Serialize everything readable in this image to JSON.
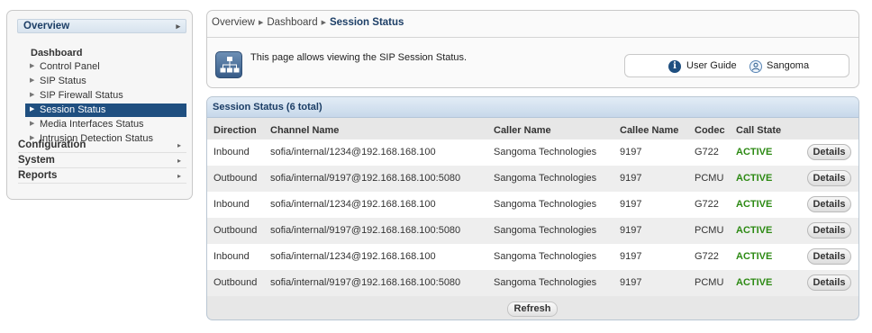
{
  "sidebar": {
    "overview": "Overview",
    "dashboard": "Dashboard",
    "items": [
      "Control Panel",
      "SIP Status",
      "SIP Firewall Status",
      "Session Status",
      "Media Interfaces Status",
      "Intrusion Detection Status"
    ],
    "selected_index": 3,
    "sections": [
      "Configuration",
      "System",
      "Reports"
    ]
  },
  "breadcrumb": {
    "root": "Overview",
    "mid": "Dashboard",
    "current": "Session Status"
  },
  "page": {
    "description": "This page allows viewing the SIP Session Status.",
    "user_guide": "User Guide",
    "user": "Sangoma"
  },
  "sessions": {
    "title": "Session Status (6 total)",
    "columns": [
      "Direction",
      "Channel Name",
      "Caller Name",
      "Callee Name",
      "Codec",
      "Call State"
    ],
    "rows": [
      {
        "direction": "Inbound",
        "channel": "sofia/internal/1234@192.168.168.100",
        "caller": "Sangoma Technologies",
        "callee": "9197",
        "codec": "G722",
        "state": "ACTIVE"
      },
      {
        "direction": "Outbound",
        "channel": "sofia/internal/9197@192.168.168.100:5080",
        "caller": "Sangoma Technologies",
        "callee": "9197",
        "codec": "PCMU",
        "state": "ACTIVE"
      },
      {
        "direction": "Inbound",
        "channel": "sofia/internal/1234@192.168.168.100",
        "caller": "Sangoma Technologies",
        "callee": "9197",
        "codec": "G722",
        "state": "ACTIVE"
      },
      {
        "direction": "Outbound",
        "channel": "sofia/internal/9197@192.168.168.100:5080",
        "caller": "Sangoma Technologies",
        "callee": "9197",
        "codec": "PCMU",
        "state": "ACTIVE"
      },
      {
        "direction": "Inbound",
        "channel": "sofia/internal/1234@192.168.168.100",
        "caller": "Sangoma Technologies",
        "callee": "9197",
        "codec": "G722",
        "state": "ACTIVE"
      },
      {
        "direction": "Outbound",
        "channel": "sofia/internal/9197@192.168.168.100:5080",
        "caller": "Sangoma Technologies",
        "callee": "9197",
        "codec": "PCMU",
        "state": "ACTIVE"
      }
    ],
    "details_label": "Details",
    "refresh_label": "Refresh"
  },
  "colors": {
    "accent": "#1f4f80",
    "active": "#2d8a14"
  }
}
